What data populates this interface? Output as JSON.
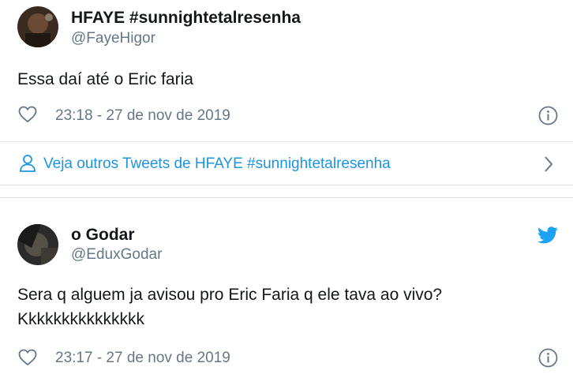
{
  "tweets": [
    {
      "display_name": "HFAYE #sunnightetalresenha",
      "handle": "@FayeHigor",
      "text_lines": [
        "Essa daí até o Eric faria"
      ],
      "timestamp": "23:18 - 27 de nov de 2019",
      "avatar_color": "#3a2a20"
    },
    {
      "display_name": "o Godar",
      "handle": "@EduxGodar",
      "text_lines": [
        "Sera q alguem ja avisou pro Eric Faria q ele tava ao vivo?",
        "Kkkkkkkkkkkkkkk"
      ],
      "timestamp": "23:17 - 27 de nov de 2019",
      "avatar_color": "#2b2b2b"
    }
  ],
  "more_tweets": {
    "label": "Veja outros Tweets de HFAYE #sunnightetalresenha"
  },
  "icons": {
    "like": "heart-outline-icon",
    "info": "info-circle-icon",
    "person": "person-outline-icon",
    "chevron": "chevron-right-icon",
    "brand": "twitter-bird-icon"
  },
  "colors": {
    "link": "#1b95e0",
    "muted": "#657786",
    "text": "#14171a",
    "divider": "#e1e8ed",
    "brand": "#1da1f2"
  }
}
